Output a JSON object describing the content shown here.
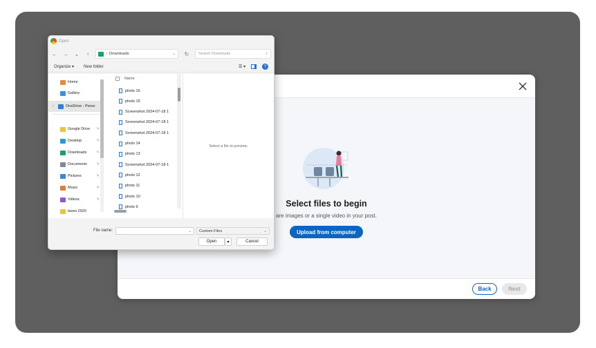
{
  "colors": {
    "linkedin_blue": "#0a66c2",
    "stage": "#5f5f5f"
  },
  "modal": {
    "close_icon": "close-icon",
    "title": "Select files to begin",
    "subtitle": "are images or a single video in your post.",
    "upload_label": "Upload from computer",
    "back_label": "Back",
    "next_label": "Next"
  },
  "dialog": {
    "title": "Open",
    "address": "Downloads",
    "search_placeholder": "Search Downloads",
    "organize_label": "Organize",
    "newfolder_label": "New folder",
    "nav_items": [
      {
        "label": "Home",
        "icon": "home-icon"
      },
      {
        "label": "Gallery",
        "icon": "gallery-icon"
      },
      {
        "label": "OneDrive - Perso",
        "icon": "onedrive-icon"
      },
      {
        "label": "Google Drive",
        "icon": "folder-icon"
      },
      {
        "label": "Desktop",
        "icon": "desktop-icon"
      },
      {
        "label": "Downloads",
        "icon": "downloads-icon"
      },
      {
        "label": "Documents",
        "icon": "documents-icon"
      },
      {
        "label": "Pictures",
        "icon": "pictures-icon"
      },
      {
        "label": "Music",
        "icon": "music-icon"
      },
      {
        "label": "Videos",
        "icon": "videos-icon"
      },
      {
        "label": "taxes 2020",
        "icon": "folder-icon"
      }
    ],
    "column_name": "Name",
    "files": [
      "photo 16",
      "photo 15",
      "Screenshot 2024-07-18 1",
      "Screenshot 2024-07-18 1",
      "Screenshot 2024-07-18 1",
      "photo 14",
      "photo 13",
      "Screenshot 2024-07-18 1",
      "photo 12",
      "photo 11",
      "photo 10",
      "photo 9"
    ],
    "preview_text": "Select a file to preview.",
    "filename_label": "File name:",
    "filename_value": "",
    "filter_value": "Custom Files",
    "open_label": "Open",
    "cancel_label": "Cancel"
  }
}
